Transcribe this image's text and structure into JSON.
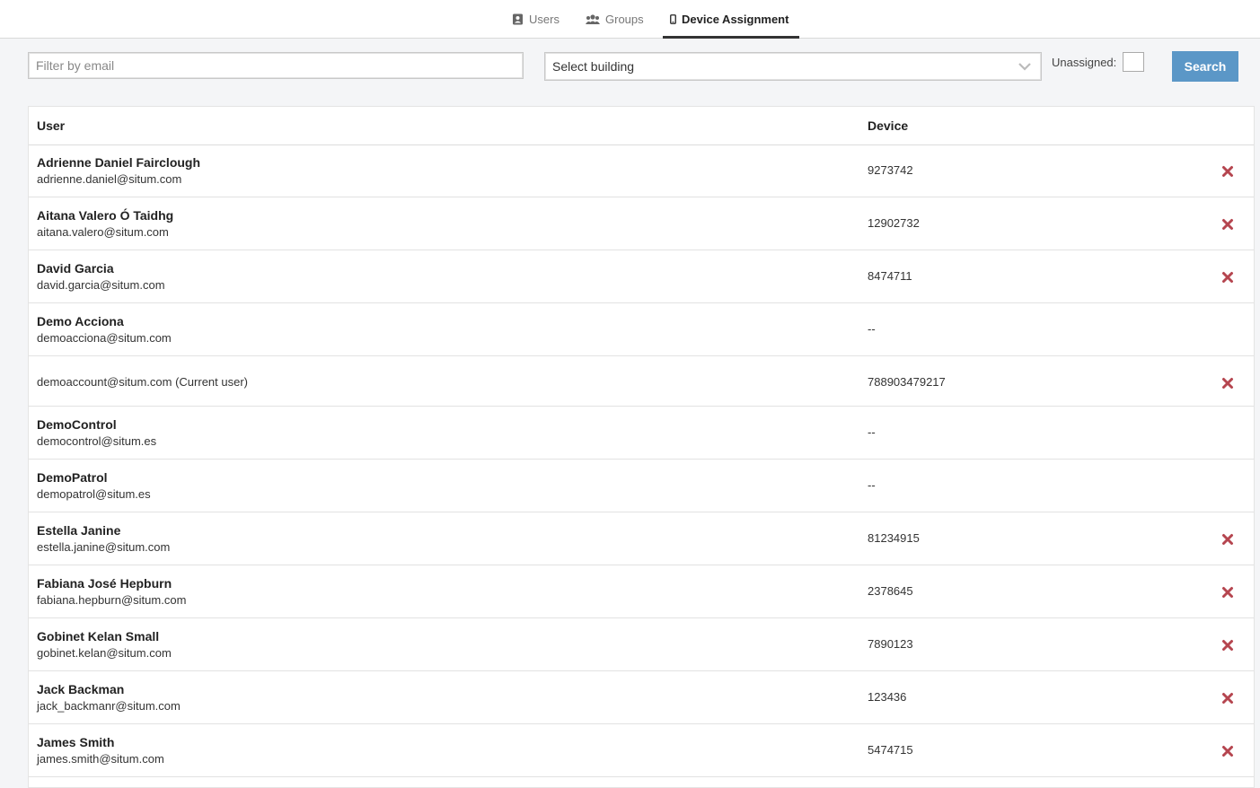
{
  "tabs": [
    {
      "label": "Users",
      "icon": "contact-book-icon"
    },
    {
      "label": "Groups",
      "icon": "users-icon"
    },
    {
      "label": "Device Assignment",
      "icon": "mobile-icon",
      "active": true
    }
  ],
  "filters": {
    "email_placeholder": "Filter by email",
    "email_value": "",
    "building_selected": "Select building",
    "unassigned_label": "Unassigned:",
    "unassigned_checked": false,
    "search_label": "Search"
  },
  "table": {
    "headers": {
      "user": "User",
      "device": "Device"
    },
    "rows": [
      {
        "name": "Adrienne Daniel Fairclough",
        "email": "adrienne.daniel@situm.com",
        "device": "9273742",
        "removable": true
      },
      {
        "name": "Aitana Valero Ó Taidhg",
        "email": "aitana.valero@situm.com",
        "device": "12902732",
        "removable": true
      },
      {
        "name": "David Garcia",
        "email": "david.garcia@situm.com",
        "device": "8474711",
        "removable": true
      },
      {
        "name": "Demo Acciona",
        "email": "demoacciona@situm.com",
        "device": "--",
        "removable": false
      },
      {
        "name": "",
        "email": "demoaccount@situm.com (Current user)",
        "device": "788903479217",
        "removable": true
      },
      {
        "name": "DemoControl",
        "email": "democontrol@situm.es",
        "device": "--",
        "removable": false
      },
      {
        "name": "DemoPatrol",
        "email": "demopatrol@situm.es",
        "device": "--",
        "removable": false
      },
      {
        "name": "Estella Janine",
        "email": "estella.janine@situm.com",
        "device": "81234915",
        "removable": true
      },
      {
        "name": "Fabiana José Hepburn",
        "email": "fabiana.hepburn@situm.com",
        "device": "2378645",
        "removable": true
      },
      {
        "name": "Gobinet Kelan Small",
        "email": "gobinet.kelan@situm.com",
        "device": "7890123",
        "removable": true
      },
      {
        "name": "Jack Backman",
        "email": "jack_backmanr@situm.com",
        "device": "123436",
        "removable": true
      },
      {
        "name": "James Smith",
        "email": "james.smith@situm.com",
        "device": "5474715",
        "removable": true
      }
    ]
  },
  "colors": {
    "accent": "#5b97c7",
    "delete": "#b5454f"
  }
}
